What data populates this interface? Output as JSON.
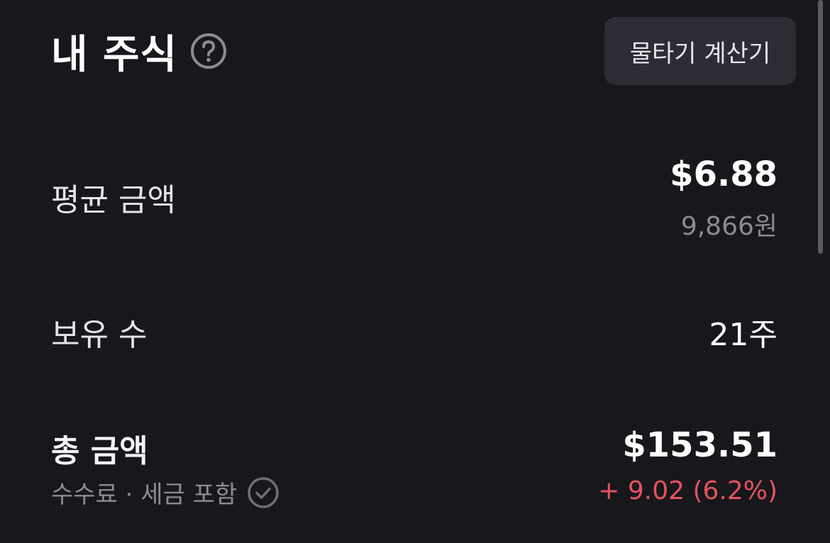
{
  "header": {
    "title": "내 주식",
    "calc_button_label": "물타기 계산기"
  },
  "rows": {
    "average": {
      "label": "평균 금액",
      "value_usd": "$6.88",
      "value_krw": "9,866원"
    },
    "holdings": {
      "label": "보유 수",
      "value": "21주"
    },
    "total": {
      "label": "총 금액",
      "sublabel": "수수료 · 세금 포함",
      "value_usd": "$153.51",
      "change": "+ 9.02 (6.2%)"
    }
  },
  "icons": {
    "help": "question-circle-icon",
    "check": "check-circle-icon"
  },
  "colors": {
    "background": "#17171c",
    "button_bg": "#2c2c35",
    "gain": "#e5535e",
    "muted": "#8b8b93"
  }
}
